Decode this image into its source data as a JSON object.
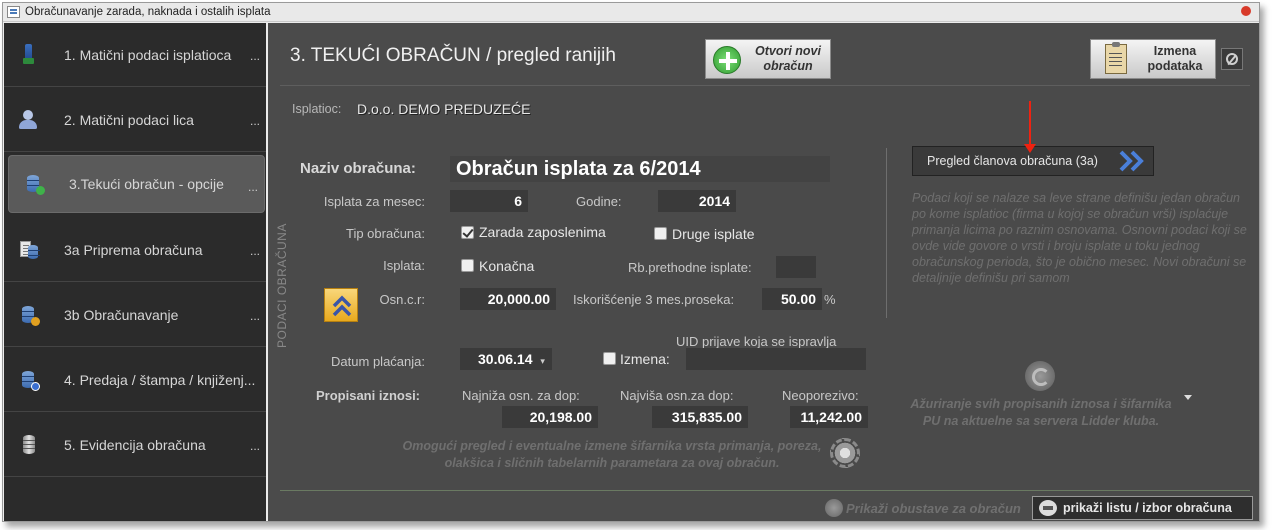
{
  "window": {
    "title": "Obračunavanje zarada, naknada i ostalih isplata"
  },
  "sidebar": {
    "items": [
      {
        "label": "1. Matični podaci isplatioca",
        "icon": "bottle-icon",
        "dots": "..."
      },
      {
        "label": "2. Matični podaci lica",
        "icon": "person-icon",
        "dots": "..."
      },
      {
        "label": "3.Tekući obračun - opcije",
        "icon": "database-check-icon",
        "dots": "...",
        "active": true
      },
      {
        "label": "3a Priprema obračuna",
        "icon": "sheet-database-icon",
        "dots": "..."
      },
      {
        "label": "3b Obračunavanje",
        "icon": "database-star-icon",
        "dots": "..."
      },
      {
        "label": "4. Predaja / štampa / knjiženj...",
        "icon": "database-info-icon",
        "dots": ""
      },
      {
        "label": "5. Evidencija obračuna",
        "icon": "cylinder-icon",
        "dots": "..."
      }
    ]
  },
  "header": {
    "title": "3. TEKUĆI OBRAČUN / pregled ranijih",
    "new_button": "Otvori novi obračun",
    "edit_button": "Izmena podataka"
  },
  "payer": {
    "label": "Isplatioc:",
    "value": "D.o.o. DEMO PREDUZEĆE"
  },
  "section_label": "PODACI OBRAČUNA",
  "form": {
    "naziv_label": "Naziv obračuna:",
    "naziv_value": "Obračun isplata za 6/2014",
    "mesec_label": "Isplata za mesec:",
    "mesec_value": "6",
    "godine_label": "Godine:",
    "godine_value": "2014",
    "tip_label": "Tip obračuna:",
    "tip_zarada": "Zarada zaposlenima",
    "tip_druge": "Druge isplate",
    "isplata_label": "Isplata:",
    "konacna": "Konačna",
    "rb_label": "Rb.prethodne isplate:",
    "rb_value": "",
    "osn_label": "Osn.c.r:",
    "osn_value": "20,000.00",
    "iskor_label": "Iskorišćenje 3 mes.proseka:",
    "iskor_value": "50.00",
    "iskor_unit": "%",
    "datum_label": "Datum plaćanja:",
    "datum_value": "30.06.14",
    "izmena_label": "Izmena:",
    "uid_label": "UID prijave koja se ispravlja",
    "uid_value": "",
    "propisani_label": "Propisani iznosi:",
    "najniza_label": "Najniža osn. za dop:",
    "najniza_value": "20,198.00",
    "najvisa_label": "Najviša osn.za dop:",
    "najvisa_value": "315,835.00",
    "neoporezivo_label": "Neoporezivo:",
    "neoporezivo_value": "11,242.00",
    "sifarnik_hint": "Omogući pregled i eventualne izmene šifarnika vrsta primanja, poreza, olakšica i sličnih tabelarnih parametara za ovaj obračun."
  },
  "right": {
    "pregled_button": "Pregled članova obračuna (3a)",
    "info": "Podaci koji se nalaze sa leve strane definišu jedan obračun po kome isplatioc (firma u kojoj se obračun vrši) isplaćuje primanja licima po raznim osnovama. Osnovni podaci koji se ovde vide govore o vrsti i broju isplate u toku jednog obračunskog perioda, što je obično mesec. Novi obračuni se detaljnije definišu pri samom",
    "update_text": "Ažuriranje svih propisanih iznosa i šifarnika PU na aktuelne sa servera Lidder kluba."
  },
  "bottom": {
    "obustave": "Prikaži obustave za obračun",
    "lista_button": "prikaži listu / izbor obračuna"
  },
  "colors": {
    "panel": "#4b4b4b",
    "sidebar": "#2b2b2b",
    "accent_arrow": "#4a7fd9",
    "marker": "#e21"
  }
}
